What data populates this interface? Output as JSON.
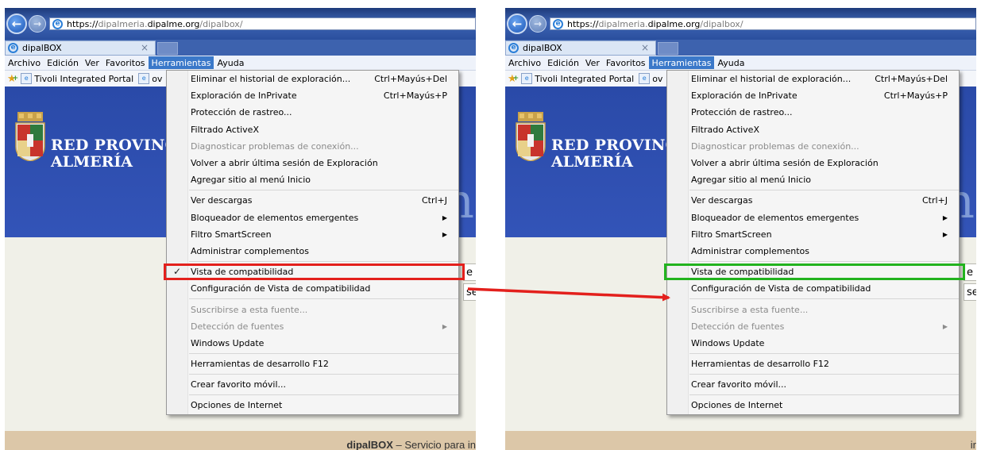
{
  "browser": {
    "url": {
      "scheme": "https://",
      "subdomain": "dipalmeria.",
      "domain": "dipalme.org",
      "path": "/dipalbox/"
    },
    "tab_title": "dipalBOX",
    "tab_close": "×"
  },
  "menubar": {
    "items": [
      "Archivo",
      "Edición",
      "Ver",
      "Favoritos",
      "Herramientas",
      "Ayuda"
    ],
    "active_item": "Herramientas"
  },
  "favorites_bar": {
    "link1": "Tivoli Integrated Portal",
    "link2": "ov"
  },
  "page": {
    "brand_line1": "RED PROVINCI",
    "brand_line2": "ALMERÍA",
    "side_fragment": "n",
    "fragment_e": "e",
    "fragment_se": "se",
    "footer_bold": "dipalBOX",
    "footer_rest": " – Servicio para in",
    "footer_right_frag": "ir"
  },
  "tools_menu": {
    "item_delete_history": "Eliminar el historial de exploración...",
    "shortcut_delete_history": "Ctrl+Mayús+Del",
    "item_inprivate": "Exploración de InPrivate",
    "shortcut_inprivate": "Ctrl+Mayús+P",
    "item_tracking": "Protección de rastreo...",
    "item_activex": "Filtrado ActiveX",
    "item_diagnose": "Diagnosticar problemas de conexión...",
    "item_reopen": "Volver a abrir última sesión de Exploración",
    "item_add_start": "Agregar sitio al menú Inicio",
    "item_downloads": "Ver descargas",
    "shortcut_downloads": "Ctrl+J",
    "item_popup_blocker": "Bloqueador de elementos emergentes",
    "item_smartscreen": "Filtro SmartScreen",
    "item_addons": "Administrar complementos",
    "item_compat_view": "Vista de compatibilidad",
    "item_compat_settings": "Configuración de Vista de compatibilidad",
    "item_subscribe": "Suscribirse a esta fuente...",
    "item_feed_discovery": "Detección de fuentes",
    "item_windows_update": "Windows Update",
    "item_devtools": "Herramientas de desarrollo F12",
    "item_mobile_fav": "Crear favorito móvil...",
    "item_internet_options": "Opciones de Internet"
  },
  "state": {
    "left_compat_checked": true,
    "right_compat_checked": false
  },
  "colors": {
    "highlight_before": "#e3201c",
    "highlight_after": "#22b31e",
    "arrow": "#e3201c",
    "menu_active": "#3a78c9"
  },
  "icons": {
    "back": "back-arrow-icon",
    "forward": "forward-arrow-icon",
    "ie": "ie-logo-icon",
    "favorites": "favorites-star-icon",
    "check": "checkmark-icon",
    "submenu": "submenu-arrow-icon"
  }
}
